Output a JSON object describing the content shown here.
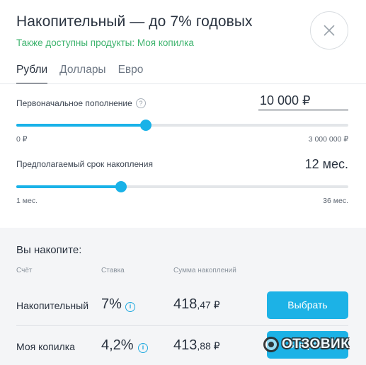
{
  "header": {
    "title": "Накопительный — до 7% годовых",
    "subtitle": "Также доступны продукты: Моя копилка"
  },
  "tabs": [
    {
      "label": "Рубли",
      "active": true
    },
    {
      "label": "Доллары",
      "active": false
    },
    {
      "label": "Евро",
      "active": false
    }
  ],
  "deposit": {
    "label": "Первоначальное пополнение",
    "help": "?",
    "value": "10 000 ₽",
    "min_label": "0 ₽",
    "max_label": "3 000 000 ₽",
    "slider_fraction": 0.39
  },
  "term": {
    "label": "Предполагаемый срок накопления",
    "value": "12 мес.",
    "min_label": "1 мес.",
    "max_label": "36 мес.",
    "slider_fraction": 0.315
  },
  "results": {
    "title": "Вы накопите:",
    "columns": {
      "account": "Счёт",
      "rate": "Ставка",
      "sum": "Сумма накоплений"
    },
    "rows": [
      {
        "name": "Накопительный",
        "rate": "7%",
        "sum_main": "418",
        "sum_kop": ",47 ₽",
        "button": "Выбрать"
      },
      {
        "name": "Моя копилка",
        "rate": "4,2%",
        "sum_main": "413",
        "sum_kop": ",88 ₽",
        "button": "Выбрать"
      }
    ]
  },
  "watermark": {
    "text": "ОТЗОВИК"
  },
  "colors": {
    "accent": "#1cb2e6",
    "subtitle_green": "#3fb46f",
    "text": "#2a3340",
    "results_bg": "#f4f5f7"
  },
  "icons": {
    "close": "close-icon",
    "help": "question-circle-icon",
    "info": "info-circle-icon"
  }
}
